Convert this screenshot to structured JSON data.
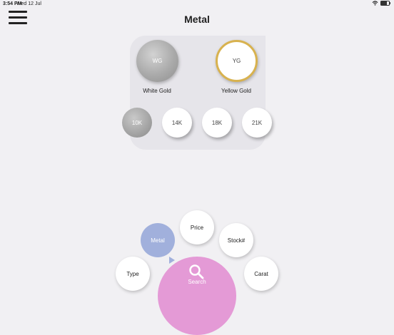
{
  "status_bar": {
    "time": "3:54 PM",
    "date": "Wed 12 Jul",
    "battery_level": 0.7
  },
  "header": {
    "title": "Metal"
  },
  "metal": {
    "options": [
      {
        "code": "WG",
        "label": "White Gold",
        "selected": true
      },
      {
        "code": "YG",
        "label": "Yellow Gold",
        "selected": false
      }
    ],
    "karats": [
      {
        "label": "10K",
        "selected": true
      },
      {
        "label": "14K",
        "selected": false
      },
      {
        "label": "18K",
        "selected": false
      },
      {
        "label": "21K",
        "selected": false
      }
    ]
  },
  "filter_menu": {
    "items": [
      "Metal",
      "Price",
      "Stock#",
      "Type",
      "Carat"
    ],
    "active": "Metal",
    "search_label": "Search"
  },
  "colors": {
    "accent_active": "#a1b0dc",
    "search_button": "#e49ad6",
    "yellow_gold_ring": "#d8b24f"
  }
}
